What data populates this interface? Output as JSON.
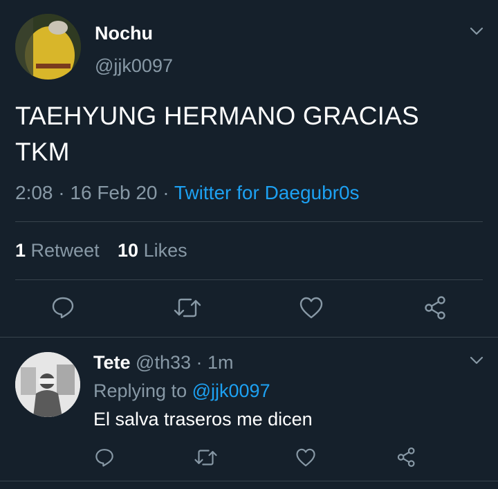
{
  "main_tweet": {
    "author_name": "Nochu",
    "author_handle": "@jjk0097",
    "text_line1": "TAEHYUNG HERMANO GRACIAS",
    "text_line2": "TKM",
    "time": "2:08",
    "date": "16 Feb 20",
    "separator": "·",
    "source": "Twitter for Daegubr0s",
    "retweet_count": "1",
    "retweet_label": "Retweet",
    "like_count": "10",
    "like_label": "Likes"
  },
  "reply": {
    "author_name": "Tete",
    "author_handle": "@th33",
    "separator": "·",
    "age": "1m",
    "replying_prefix": "Replying to",
    "replying_to": "@jjk0097",
    "text": "El salva traseros me dicen"
  },
  "icons": {
    "reply": "speech-bubble-icon",
    "retweet": "retweet-arrows-icon",
    "like": "heart-outline-icon",
    "share": "share-nodes-icon",
    "menu": "chevron-down-icon"
  },
  "colors": {
    "background": "#15202b",
    "muted": "#8899a6",
    "link": "#1da1f2",
    "divider": "#38444d"
  }
}
